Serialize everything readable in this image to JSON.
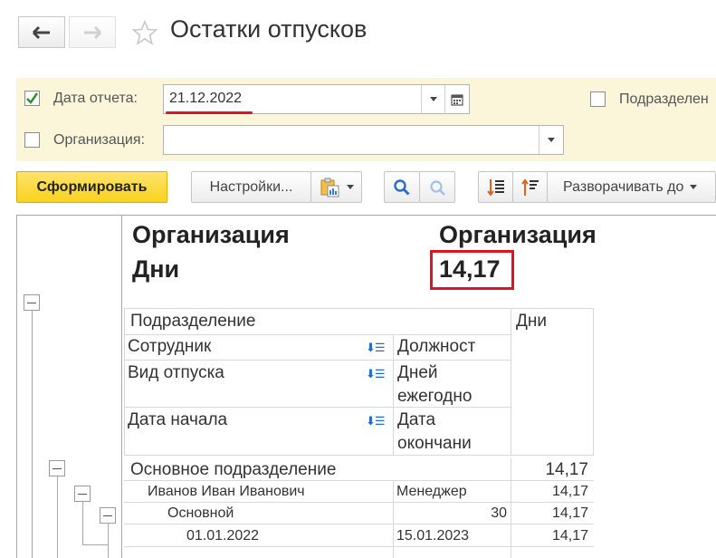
{
  "window": {
    "title": "Остатки отпусков"
  },
  "filters": {
    "date": {
      "label": "Дата отчета:",
      "value": "21.12.2022",
      "checked": true
    },
    "organization": {
      "label": "Организация:",
      "value": "",
      "checked": false
    },
    "department": {
      "label": "Подразделен",
      "checked": false
    }
  },
  "toolbar": {
    "generate": "Сформировать",
    "settings": "Настройки...",
    "expand": "Разворачивать до"
  },
  "report": {
    "header_left": {
      "line1": "Организация",
      "line2": "Дни"
    },
    "header_right": {
      "line1": "Организация",
      "value": "14,17"
    },
    "columns": {
      "department": "Подразделение",
      "days": "Дни",
      "employee": "Сотрудник",
      "position": "Должност",
      "vacation_type": "Вид отпуска",
      "annual_days_1": "Дней",
      "annual_days_2": "ежегодно",
      "start_date": "Дата начала",
      "end_date_1": "Дата",
      "end_date_2": "окончани"
    },
    "rows": {
      "dept_name": "Основное подразделение",
      "dept_days": "14,17",
      "emp_name": "Иванов Иван Иванович",
      "emp_position": "Менеджер",
      "emp_days": "14,17",
      "vac_type": "Основной",
      "vac_annual": "30",
      "vac_days": "14,17",
      "period_start": "01.01.2022",
      "period_end": "15.01.2023",
      "period_days": "14,17"
    }
  },
  "colors": {
    "accent_yellow": "#f9d21e",
    "filter_bg": "#fbf5d9",
    "highlight_red": "#e0141e"
  }
}
